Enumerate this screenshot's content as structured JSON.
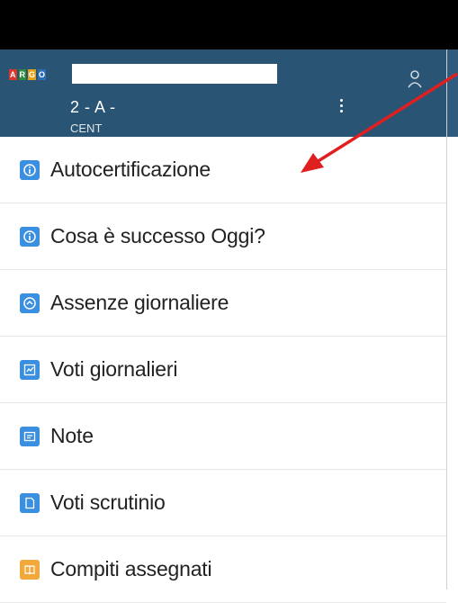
{
  "header": {
    "logo_letters": [
      "A",
      "R",
      "G",
      "O"
    ],
    "class_line": "2 - A -",
    "class_line_cut": "CENT"
  },
  "colors": {
    "header_bg": "#2a5473",
    "arrow": "#e02020",
    "icon_blue": "#3b8fe0",
    "icon_orange": "#f2a93b"
  },
  "menu": {
    "items": [
      {
        "label": "Autocertificazione",
        "icon": "info-icon",
        "color": "#3b8fe0"
      },
      {
        "label": "Cosa è successo Oggi?",
        "icon": "info-icon",
        "color": "#3b8fe0"
      },
      {
        "label": "Assenze giornaliere",
        "icon": "calendar-icon",
        "color": "#3b8fe0"
      },
      {
        "label": "Voti giornalieri",
        "icon": "grades-icon",
        "color": "#3b8fe0"
      },
      {
        "label": "Note",
        "icon": "note-icon",
        "color": "#3b8fe0"
      },
      {
        "label": "Voti scrutinio",
        "icon": "document-icon",
        "color": "#3b8fe0"
      },
      {
        "label": "Compiti assegnati",
        "icon": "book-icon",
        "color": "#f2a93b"
      }
    ]
  }
}
